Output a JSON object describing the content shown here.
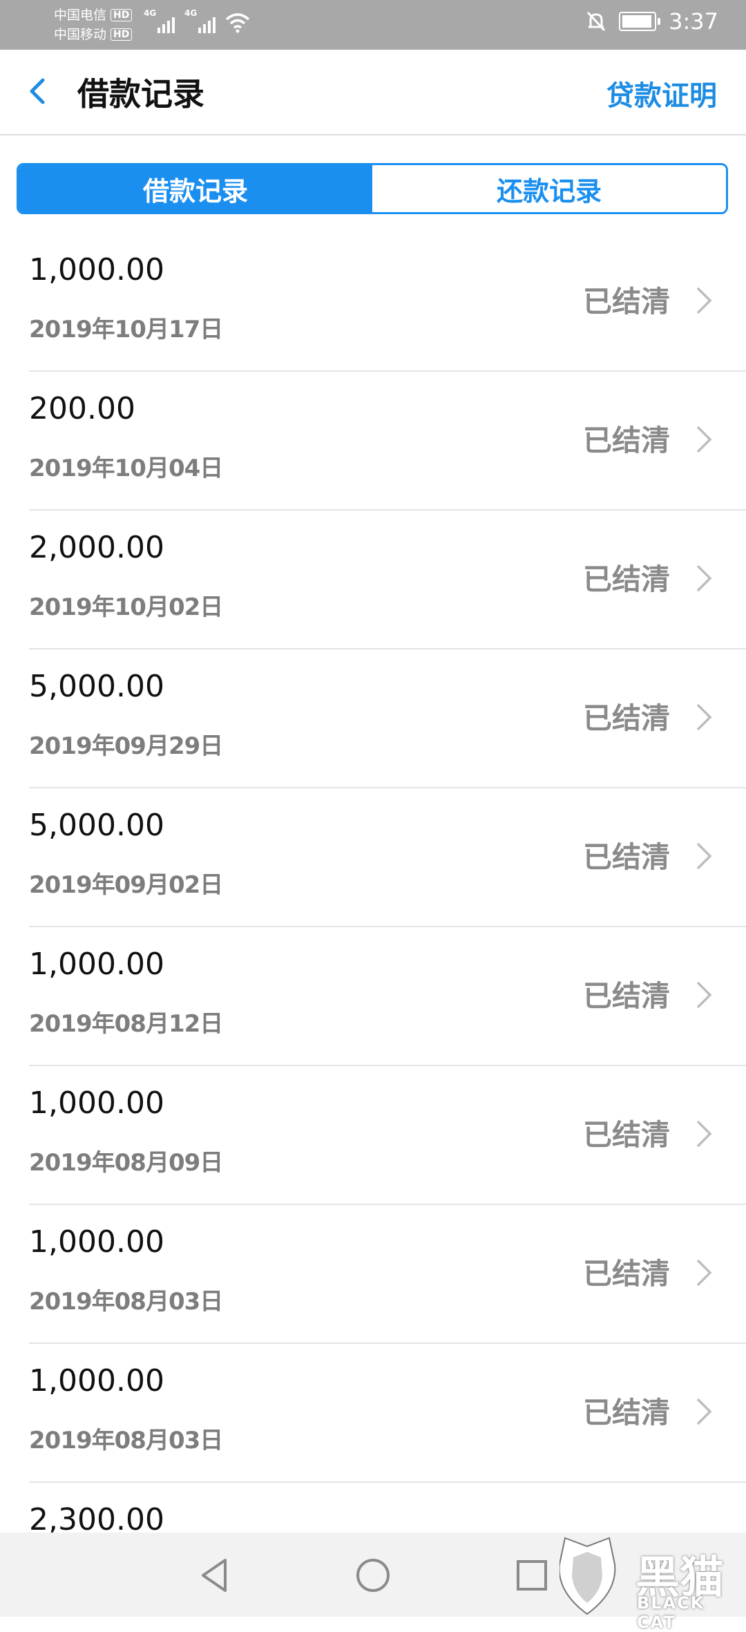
{
  "status_bar": {
    "carrier1": "中国电信",
    "carrier2": "中国移动",
    "hd": "HD",
    "network": "4G",
    "time": "3:37"
  },
  "header": {
    "title": "借款记录",
    "right_link": "贷款证明"
  },
  "tabs": [
    {
      "label": "借款记录",
      "active": true
    },
    {
      "label": "还款记录",
      "active": false
    }
  ],
  "records": [
    {
      "amount": "1,000.00",
      "date": "2019年10月17日",
      "status": "已结清"
    },
    {
      "amount": "200.00",
      "date": "2019年10月04日",
      "status": "已结清"
    },
    {
      "amount": "2,000.00",
      "date": "2019年10月02日",
      "status": "已结清"
    },
    {
      "amount": "5,000.00",
      "date": "2019年09月29日",
      "status": "已结清"
    },
    {
      "amount": "5,000.00",
      "date": "2019年09月02日",
      "status": "已结清"
    },
    {
      "amount": "1,000.00",
      "date": "2019年08月12日",
      "status": "已结清"
    },
    {
      "amount": "1,000.00",
      "date": "2019年08月09日",
      "status": "已结清"
    },
    {
      "amount": "1,000.00",
      "date": "2019年08月03日",
      "status": "已结清"
    },
    {
      "amount": "1,000.00",
      "date": "2019年08月03日",
      "status": "已结清"
    },
    {
      "amount": "2,300.00",
      "date": "",
      "status": ""
    }
  ],
  "nav": {
    "back_icon": "triangle-back-icon",
    "home_icon": "circle-home-icon",
    "recents_icon": "square-recents-icon"
  },
  "watermark": {
    "text": "黑猫",
    "sub": "BLACK CAT"
  },
  "colors": {
    "accent": "#1a8ff0",
    "status_bar": "#a8a8a8",
    "muted_text": "#8a8a8a"
  }
}
